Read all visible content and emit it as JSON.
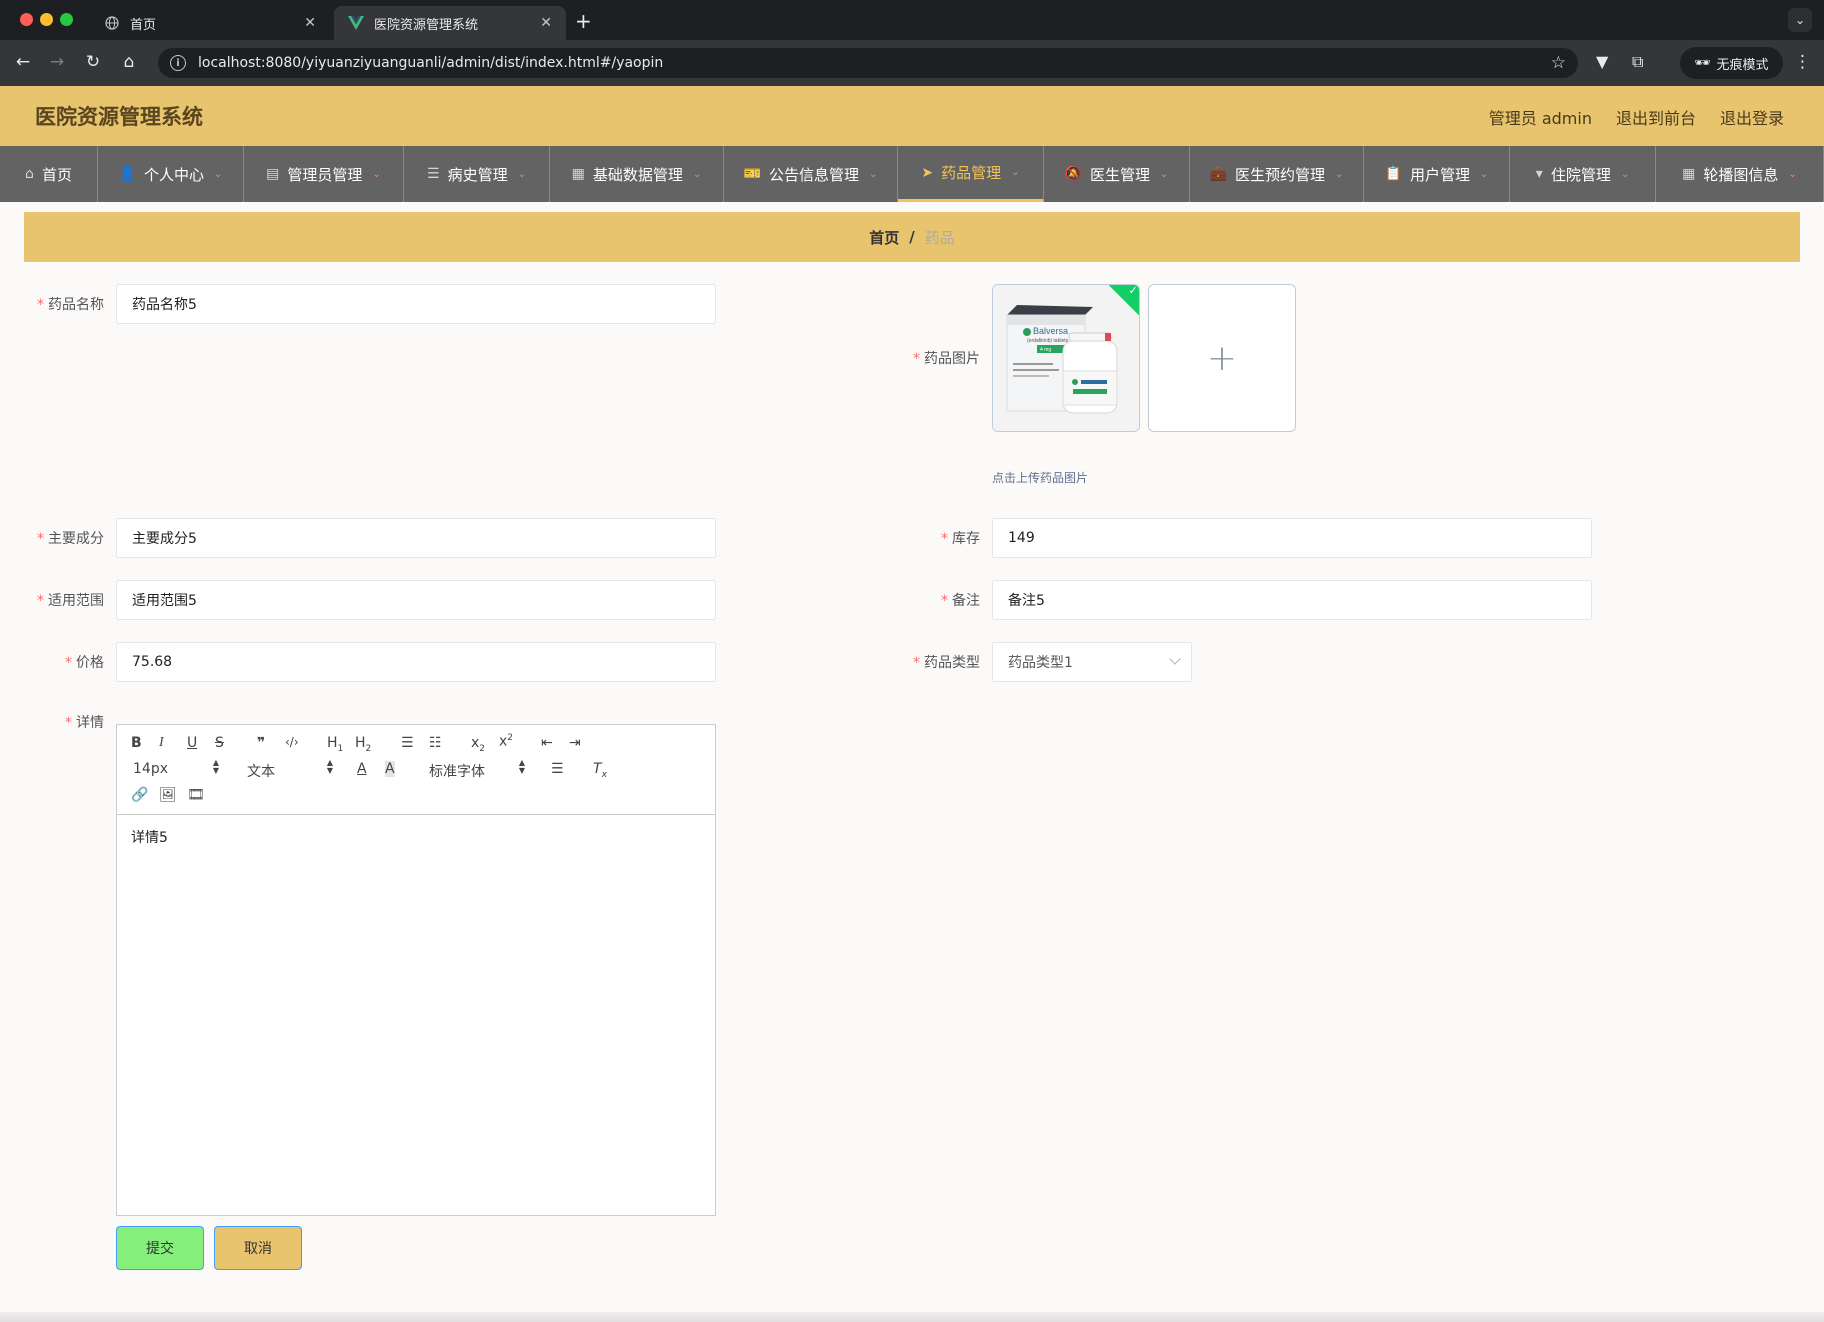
{
  "browser": {
    "tabs": [
      {
        "title": "首页",
        "active": false
      },
      {
        "title": "医院资源管理系统",
        "active": true
      }
    ],
    "url": "localhost:8080/yiyuanziyuanguanli/admin/dist/index.html#/yaopin",
    "incognito_label": "无痕模式"
  },
  "header": {
    "title": "医院资源管理系统",
    "user": "管理员 admin",
    "to_front": "退出到前台",
    "logout": "退出登录"
  },
  "nav": [
    {
      "label": "首页",
      "icon": "home-icon",
      "arrow": false,
      "active": false,
      "width": 98
    },
    {
      "label": "个人中心",
      "icon": "user-icon",
      "arrow": true,
      "active": false,
      "width": 146
    },
    {
      "label": "管理员管理",
      "icon": "chart-icon",
      "arrow": true,
      "active": false,
      "width": 160
    },
    {
      "label": "病史管理",
      "icon": "list-icon",
      "arrow": true,
      "active": false,
      "width": 146
    },
    {
      "label": "基础数据管理",
      "icon": "grid-icon",
      "arrow": true,
      "active": false,
      "width": 174
    },
    {
      "label": "公告信息管理",
      "icon": "ticket-icon",
      "arrow": true,
      "active": false,
      "width": 174
    },
    {
      "label": "药品管理",
      "icon": "send-icon",
      "arrow": true,
      "active": true,
      "width": 146
    },
    {
      "label": "医生管理",
      "icon": "bell-off-icon",
      "arrow": true,
      "active": false,
      "width": 146
    },
    {
      "label": "医生预约管理",
      "icon": "briefcase-icon",
      "arrow": true,
      "active": false,
      "width": 174
    },
    {
      "label": "用户管理",
      "icon": "clipboard-icon",
      "arrow": true,
      "active": false,
      "width": 146
    },
    {
      "label": "住院管理",
      "icon": "stamp-icon",
      "arrow": true,
      "active": false,
      "width": 146
    },
    {
      "label": "轮播图信息",
      "icon": "apps-icon",
      "arrow": true,
      "active": false,
      "width": 168
    }
  ],
  "breadcrumb": {
    "home": "首页",
    "sep": "/",
    "current": "药品"
  },
  "form": {
    "name_label": "药品名称",
    "name_value": "药品名称5",
    "image_label": "药品图片",
    "image_tip": "点击上传药品图片",
    "ingredient_label": "主要成分",
    "ingredient_value": "主要成分5",
    "stock_label": "库存",
    "stock_value": "149",
    "scope_label": "适用范围",
    "scope_value": "适用范围5",
    "remark_label": "备注",
    "remark_value": "备注5",
    "price_label": "价格",
    "price_value": "75.68",
    "type_label": "药品类型",
    "type_value": "药品类型1",
    "detail_label": "详情",
    "detail_value": "详情5",
    "required_mark": "*"
  },
  "editor": {
    "font_size": "14px",
    "block_type": "文本",
    "font_family": "标准字体"
  },
  "product_image": {
    "brand": "Balversa",
    "subtitle": "(erdafitinib) tablets",
    "dose": "4 mg"
  },
  "buttons": {
    "submit": "提交",
    "cancel": "取消"
  },
  "colors": {
    "header": "#e8c46e",
    "nav": "#636363",
    "active": "#f0c35c",
    "submit": "#86ee7b",
    "required": "#f56c6c"
  }
}
